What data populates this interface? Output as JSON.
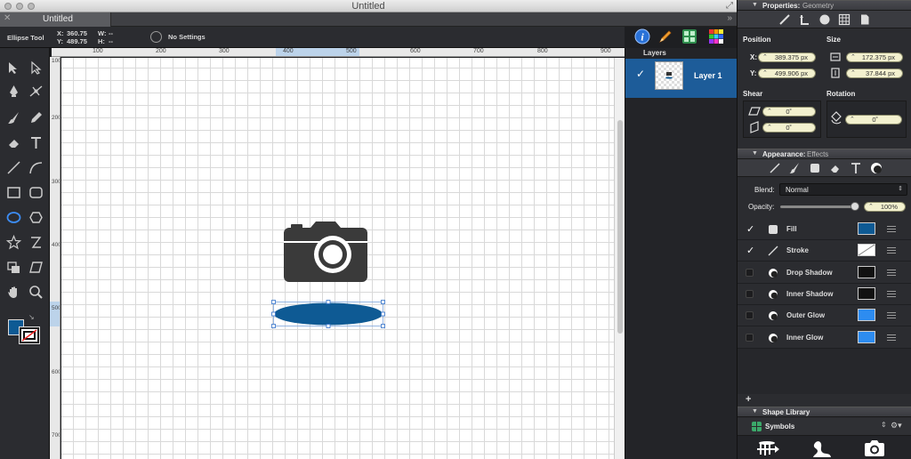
{
  "window": {
    "title": "Untitled",
    "tab_label": "Untitled",
    "tab_close": "✕",
    "overflow": "»",
    "fullscreen": "⤢"
  },
  "tool_options": {
    "tool_name": "Ellipse Tool",
    "x_label": "X:",
    "x_value": "360.75",
    "y_label": "Y:",
    "y_value": "489.75",
    "w_label": "W:",
    "w_value": "--",
    "h_label": "H:",
    "h_value": "--",
    "settings": "No Settings"
  },
  "ruler": {
    "h_labels": [
      "100",
      "200",
      "300",
      "400",
      "500",
      "600",
      "700",
      "800",
      "900"
    ],
    "v_labels": [
      "100",
      "200",
      "300",
      "400",
      "500",
      "600",
      "700"
    ]
  },
  "layers": {
    "title": "Layers",
    "items": [
      {
        "name": "Layer 1",
        "checked": "✓"
      }
    ]
  },
  "properties": {
    "header": "Properties:",
    "header_tab": "Geometry",
    "position_label": "Position",
    "size_label": "Size",
    "x_label": "X:",
    "x_value": "389.375 px",
    "y_label": "Y:",
    "y_value": "499.906 px",
    "width_value": "172.375 px",
    "height_value": "37.844 px",
    "shear_label": "Shear",
    "rotation_label": "Rotation",
    "shear_h": "0˚",
    "shear_v": "0˚",
    "rotation": "0˚"
  },
  "appearance": {
    "header": "Appearance:",
    "header_tab": "Effects",
    "blend_label": "Blend:",
    "blend_value": "Normal",
    "opacity_label": "Opacity:",
    "opacity_value": "100%",
    "opacity_fraction": 1.0,
    "effects": [
      {
        "name": "Fill",
        "enabled": true,
        "check": "✓",
        "swatch": "#0e5a94"
      },
      {
        "name": "Stroke",
        "enabled": true,
        "check": "✓",
        "swatch": "none"
      },
      {
        "name": "Drop Shadow",
        "enabled": false,
        "check": "",
        "swatch": "#111111"
      },
      {
        "name": "Inner Shadow",
        "enabled": false,
        "check": "",
        "swatch": "#111111"
      },
      {
        "name": "Outer Glow",
        "enabled": false,
        "check": "",
        "swatch": "#2d8cf0"
      },
      {
        "name": "Inner Glow",
        "enabled": false,
        "check": "",
        "swatch": "#2d8cf0"
      }
    ],
    "add": "+"
  },
  "shape_library": {
    "header": "Shape Library",
    "category": "Symbols"
  },
  "colors": {
    "accent": "#1d5c99",
    "ellipse_fill": "#0e5a94",
    "camera": "#3a3a3a",
    "handle": "#2f6fc8"
  }
}
